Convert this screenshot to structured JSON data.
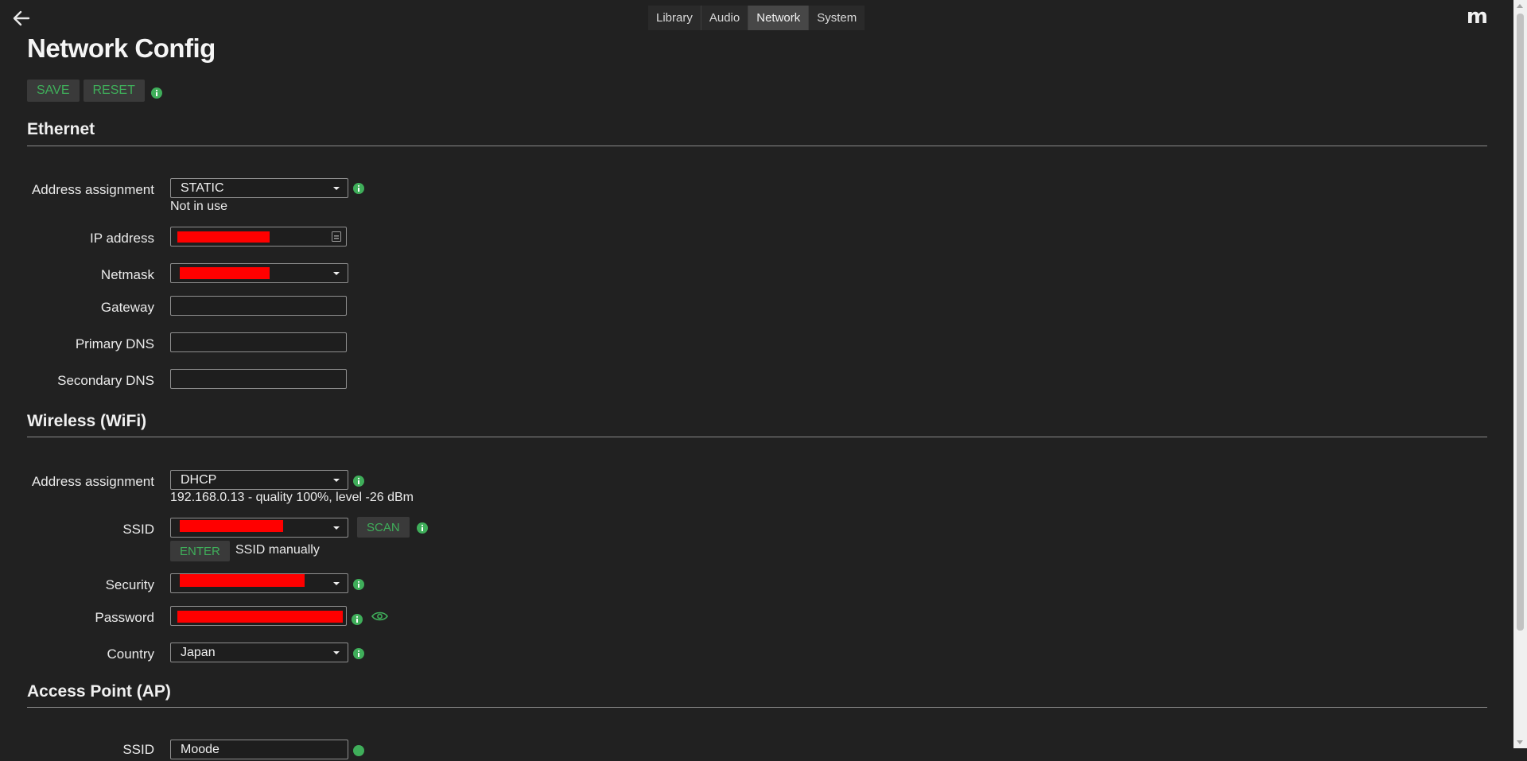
{
  "nav": {
    "tabs": [
      {
        "label": "Library"
      },
      {
        "label": "Audio"
      },
      {
        "label": "Network"
      },
      {
        "label": "System"
      }
    ],
    "active_tab": "Network",
    "logo": "m"
  },
  "page": {
    "title": "Network Config",
    "save_label": "SAVE",
    "reset_label": "RESET"
  },
  "ethernet": {
    "heading": "Ethernet",
    "address_assignment_label": "Address assignment",
    "address_assignment_value": "STATIC",
    "status": "Not in use",
    "ip_label": "IP address",
    "netmask_label": "Netmask",
    "gateway_label": "Gateway",
    "gateway_value": "",
    "primary_dns_label": "Primary DNS",
    "primary_dns_value": "",
    "secondary_dns_label": "Secondary DNS",
    "secondary_dns_value": ""
  },
  "wifi": {
    "heading": "Wireless (WiFi)",
    "address_assignment_label": "Address assignment",
    "address_assignment_value": "DHCP",
    "status": "192.168.0.13 - quality 100%, level -26 dBm",
    "ssid_label": "SSID",
    "scan_label": "SCAN",
    "enter_label": "ENTER",
    "enter_suffix": "SSID manually",
    "security_label": "Security",
    "password_label": "Password",
    "country_label": "Country",
    "country_value": "Japan"
  },
  "ap": {
    "heading": "Access Point (AP)",
    "ssid_label": "SSID",
    "ssid_value": "Moode"
  },
  "colors": {
    "accent_green": "#3fae5a",
    "background": "#212121",
    "redaction": "#ff0000"
  }
}
